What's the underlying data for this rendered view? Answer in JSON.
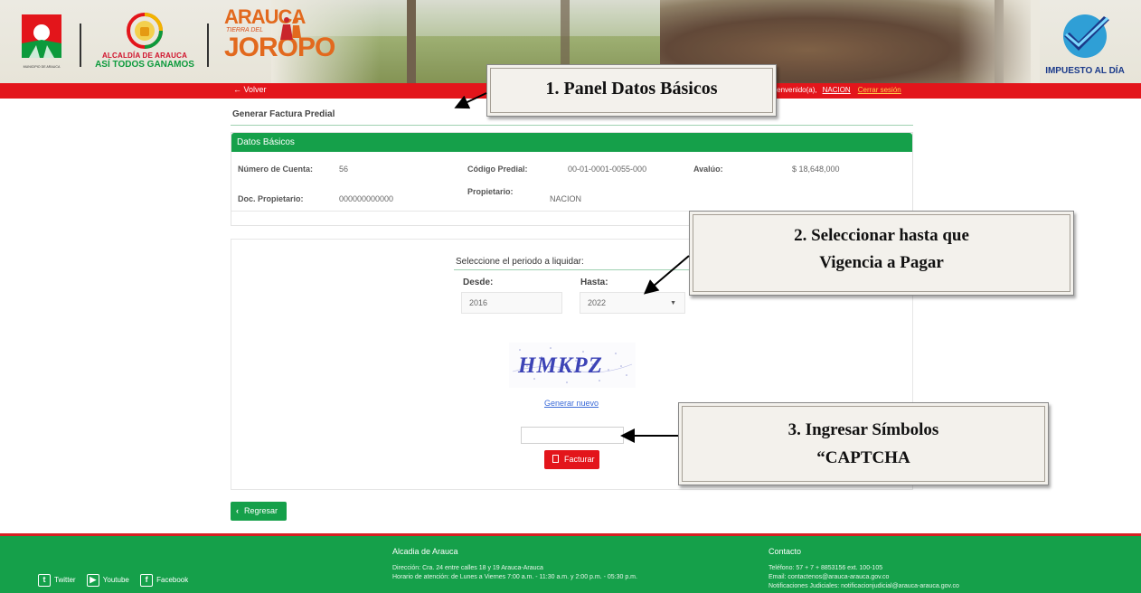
{
  "header": {
    "alcaldia_line1": "ALCALDÍA DE ARAUCA",
    "alcaldia_line2": "ASÍ TODOS GANAMOS",
    "arauca_word": "ARAUCA",
    "arauca_sub": "TIERRA DEL",
    "joropo_word": "JOROPO",
    "impuesto_label": "IMPUESTO AL DÍA",
    "municipio_label": "MUNICIPIO DE ARAUCA"
  },
  "nav": {
    "back_label": "← Volver",
    "welcome_label": "Bienvenido(a),",
    "user_name": "NACION",
    "logout_label": "Cerrar sesión"
  },
  "page": {
    "title": "Generar Factura Predial"
  },
  "basic_data": {
    "panel_title": "Datos Básicos",
    "account_label": "Número de Cuenta:",
    "account_value": "56",
    "predial_label": "Código Predial:",
    "predial_value": "00-01-0001-0055-000",
    "avaluo_label": "Avalúo:",
    "avaluo_value": "$ 18,648,000",
    "doc_label": "Doc. Propietario:",
    "doc_value": "000000000000",
    "owner_label": "Propietario:",
    "owner_value": "NACION"
  },
  "period": {
    "title": "Seleccione el periodo a liquidar:",
    "from_label": "Desde:",
    "from_value": "2016",
    "to_label": "Hasta:",
    "to_value": "2022"
  },
  "captcha": {
    "code": "HMKPZ",
    "regenerate_label": "Generar nuevo",
    "input_value": "",
    "submit_label": "Facturar"
  },
  "actions": {
    "back_button_label": "Regresar"
  },
  "callouts": {
    "c1": "1. Panel Datos Básicos",
    "c2_line1": "2. Seleccionar hasta que",
    "c2_line2": "Vigencia a Pagar",
    "c3_line1": "3. Ingresar Símbolos",
    "c3_line2": "“CAPTCHA"
  },
  "footer": {
    "social": {
      "twitter": "Twitter",
      "youtube": "Youtube",
      "facebook": "Facebook"
    },
    "org_title": "Alcadia de Arauca",
    "address": "Dirección: Cra. 24 entre calles 18 y 19 Arauca-Arauca",
    "hours": "Horario de atención: de Lunes a Viernes 7:00 a.m. - 11:30 a.m. y 2:00 p.m. - 05:30 p.m.",
    "contact_title": "Contacto",
    "phone": "Teléfono: 57 + 7 + 8853156 ext. 100-105",
    "email": "Email: contactenos@arauca-arauca.gov.co",
    "notif": "Notificaciones Judiciales: notificacionjudicial@arauca-arauca.gov.co"
  },
  "colors": {
    "brand_green": "#15a04a",
    "brand_red": "#e3151b",
    "link_yellow": "#ffd24d"
  }
}
